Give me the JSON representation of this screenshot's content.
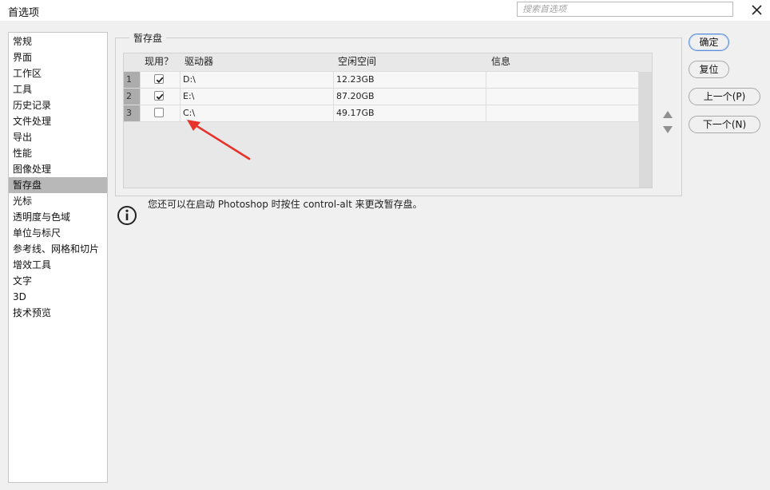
{
  "window": {
    "title": "首选项"
  },
  "search": {
    "placeholder": "搜索首选项"
  },
  "sidebar": {
    "items": [
      {
        "label": "常规"
      },
      {
        "label": "界面"
      },
      {
        "label": "工作区"
      },
      {
        "label": "工具"
      },
      {
        "label": "历史记录"
      },
      {
        "label": "文件处理"
      },
      {
        "label": "导出"
      },
      {
        "label": "性能"
      },
      {
        "label": "图像处理"
      },
      {
        "label": "暂存盘",
        "selected": true
      },
      {
        "label": "光标"
      },
      {
        "label": "透明度与色域"
      },
      {
        "label": "单位与标尺"
      },
      {
        "label": "参考线、网格和切片"
      },
      {
        "label": "增效工具"
      },
      {
        "label": "文字"
      },
      {
        "label": "3D"
      },
      {
        "label": "技术预览"
      }
    ]
  },
  "scratch": {
    "title": "暂存盘",
    "columns": {
      "active": "现用？",
      "drive": "驱动器",
      "free": "空闲空间",
      "info": "信息"
    },
    "rows": [
      {
        "num": "1",
        "checked": true,
        "drive": "D:\\",
        "free": "12.23GB",
        "info": ""
      },
      {
        "num": "2",
        "checked": true,
        "drive": "E:\\",
        "free": "87.20GB",
        "info": ""
      },
      {
        "num": "3",
        "checked": false,
        "drive": "C:\\",
        "free": "49.17GB",
        "info": ""
      }
    ],
    "hint": "您还可以在启动 Photoshop 时按住 control-alt 来更改暂存盘。"
  },
  "buttons": {
    "ok": "确定",
    "reset": "复位",
    "prev": "上一个(P)",
    "next": "下一个(N)"
  },
  "colors": {
    "accent": "#5b8ed6",
    "annotation": "#e8312a",
    "selected": "#b8b8b8"
  }
}
